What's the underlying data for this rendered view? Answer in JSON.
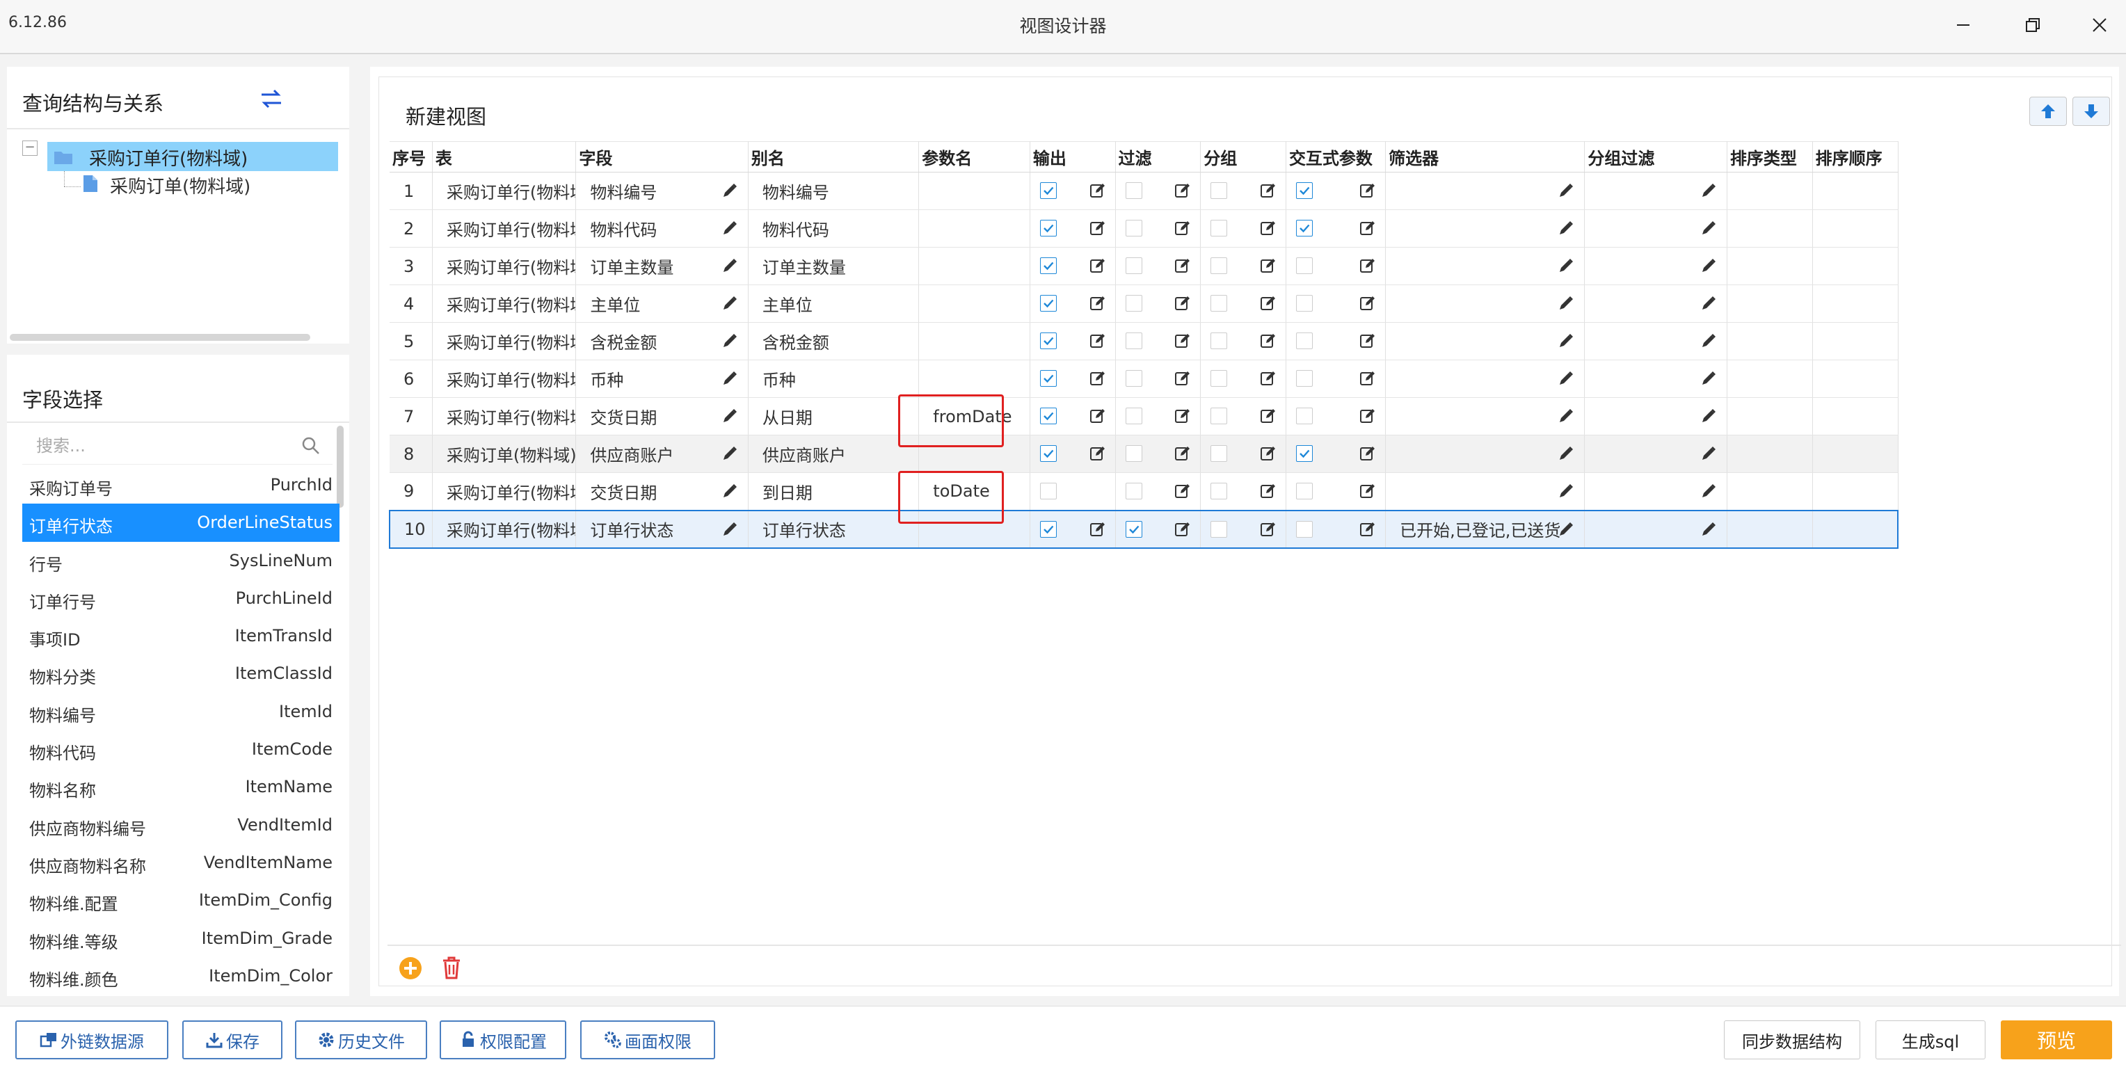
{
  "window": {
    "version": "6.12.86",
    "title": "视图设计器"
  },
  "query_panel": {
    "title": "查询结构与关系",
    "tree_root": "采购订单行(物料域)",
    "tree_child": "采购订单(物料域)"
  },
  "field_panel": {
    "title": "字段选择",
    "search_placeholder": "搜索...",
    "items": [
      {
        "name": "采购订单号",
        "code": "PurchId"
      },
      {
        "name": "订单行状态",
        "code": "OrderLineStatus",
        "selected": true
      },
      {
        "name": "行号",
        "code": "SysLineNum"
      },
      {
        "name": "订单行号",
        "code": "PurchLineId"
      },
      {
        "name": "事项ID",
        "code": "ItemTransId"
      },
      {
        "name": "物料分类",
        "code": "ItemClassId"
      },
      {
        "name": "物料编号",
        "code": "ItemId"
      },
      {
        "name": "物料代码",
        "code": "ItemCode"
      },
      {
        "name": "物料名称",
        "code": "ItemName"
      },
      {
        "name": "供应商物料编号",
        "code": "VendItemId"
      },
      {
        "name": "供应商物料名称",
        "code": "VendItemName"
      },
      {
        "name": "物料维.配置",
        "code": "ItemDim_Config"
      },
      {
        "name": "物料维.等级",
        "code": "ItemDim_Grade"
      },
      {
        "name": "物料维.颜色",
        "code": "ItemDim_Color"
      }
    ]
  },
  "view": {
    "title": "新建视图",
    "columns": [
      "序号",
      "表",
      "字段",
      "别名",
      "参数名",
      "输出",
      "过滤",
      "分组",
      "交互式参数",
      "筛选器",
      "分组过滤",
      "排序类型",
      "排序顺序"
    ],
    "rows": [
      {
        "idx": "1",
        "table": "采购订单行(物料域)",
        "field": "物料编号",
        "alias": "物料编号",
        "param": "",
        "output": true,
        "filter": false,
        "group": false,
        "interactive": true,
        "filter_text": ""
      },
      {
        "idx": "2",
        "table": "采购订单行(物料域)",
        "field": "物料代码",
        "alias": "物料代码",
        "param": "",
        "output": true,
        "filter": false,
        "group": false,
        "interactive": true,
        "filter_text": ""
      },
      {
        "idx": "3",
        "table": "采购订单行(物料域)",
        "field": "订单主数量",
        "alias": "订单主数量",
        "param": "",
        "output": true,
        "filter": false,
        "group": false,
        "interactive": false,
        "filter_text": ""
      },
      {
        "idx": "4",
        "table": "采购订单行(物料域)",
        "field": "主单位",
        "alias": "主单位",
        "param": "",
        "output": true,
        "filter": false,
        "group": false,
        "interactive": false,
        "filter_text": ""
      },
      {
        "idx": "5",
        "table": "采购订单行(物料域)",
        "field": "含税金额",
        "alias": "含税金额",
        "param": "",
        "output": true,
        "filter": false,
        "group": false,
        "interactive": false,
        "filter_text": ""
      },
      {
        "idx": "6",
        "table": "采购订单行(物料域)",
        "field": "币种",
        "alias": "币种",
        "param": "",
        "output": true,
        "filter": false,
        "group": false,
        "interactive": false,
        "filter_text": ""
      },
      {
        "idx": "7",
        "table": "采购订单行(物料域)",
        "field": "交货日期",
        "alias": "从日期",
        "param": "fromDate",
        "output": true,
        "filter": false,
        "group": false,
        "interactive": false,
        "filter_text": ""
      },
      {
        "idx": "8",
        "table": "采购订单(物料域)",
        "field": "供应商账户",
        "alias": "供应商账户",
        "param": "",
        "output": true,
        "filter": false,
        "group": false,
        "interactive": true,
        "filter_text": ""
      },
      {
        "idx": "9",
        "table": "采购订单行(物料域)",
        "field": "交货日期",
        "alias": "到日期",
        "param": "toDate",
        "output": false,
        "filter": false,
        "group": false,
        "interactive": false,
        "filter_text": ""
      },
      {
        "idx": "10",
        "table": "采购订单行(物料域)",
        "field": "订单行状态",
        "alias": "订单行状态",
        "param": "",
        "output": true,
        "filter": true,
        "group": false,
        "interactive": false,
        "filter_text": "已开始,已登记,已送货"
      }
    ]
  },
  "footer": {
    "external_source": "外链数据源",
    "save": "保存",
    "history": "历史文件",
    "permission_config": "权限配置",
    "screen_permission": "画面权限",
    "sync_structure": "同步数据结构",
    "generate_sql": "生成sql",
    "preview": "预览"
  },
  "colors": {
    "accent": "#1890ff",
    "tree_highlight": "#8cd2fb",
    "preview_button": "#f7a21b",
    "red_highlight": "#e02020"
  }
}
